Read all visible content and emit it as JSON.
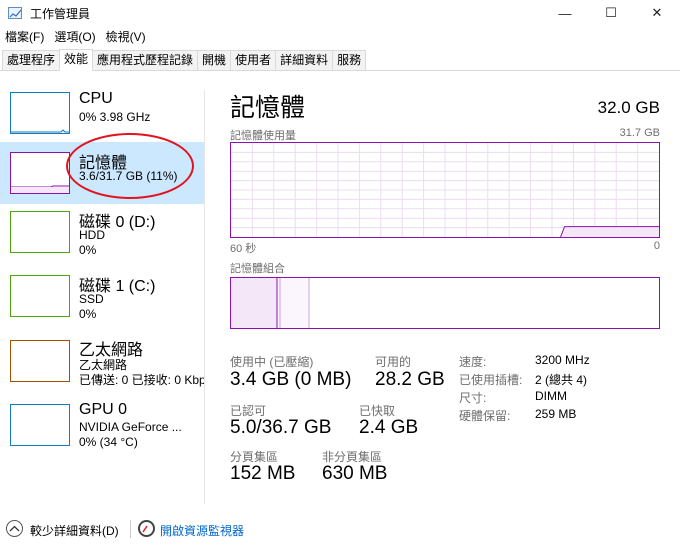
{
  "window": {
    "title": "工作管理員",
    "minimize": "—",
    "maximize": "☐",
    "close": "✕"
  },
  "menu": [
    "檔案(F)",
    "選項(O)",
    "檢視(V)"
  ],
  "tabs": [
    "處理程序",
    "效能",
    "應用程式歷程記錄",
    "開機",
    "使用者",
    "詳細資料",
    "服務"
  ],
  "sidebar": {
    "items": [
      {
        "title": "CPU",
        "sub1": "0% 3.98 GHz",
        "sub2": "",
        "sub3": "",
        "color": "#117dbb"
      },
      {
        "title": "記憶體",
        "sub1": "3.6/31.7 GB (11%)",
        "sub2": "",
        "sub3": "",
        "color": "#8b12ae"
      },
      {
        "title": "磁碟 0 (D:)",
        "sub1": "HDD",
        "sub2": "0%",
        "sub3": "",
        "color": "#4da60c"
      },
      {
        "title": "磁碟 1 (C:)",
        "sub1": "SSD",
        "sub2": "0%",
        "sub3": "",
        "color": "#4da60c"
      },
      {
        "title": "乙太網路",
        "sub1": "乙太網路",
        "sub2": "已傳送: 0 已接收: 0 Kbps",
        "sub3": "",
        "color": "#a74f01"
      },
      {
        "title": "GPU 0",
        "sub1": "NVIDIA GeForce ...",
        "sub2": "0% (34 °C)",
        "sub3": "",
        "color": "#117dbb"
      }
    ]
  },
  "main": {
    "title": "記憶體",
    "total": "32.0 GB",
    "usage_label": "記憶體使用量",
    "usage_max": "31.7 GB",
    "time_left": "60 秒",
    "time_right": "0",
    "composition_label": "記憶體組合",
    "usage_fraction": 0.11,
    "stats": {
      "in_use_label": "使用中 (已壓縮)",
      "in_use_value": "3.4 GB (0 MB)",
      "available_label": "可用的",
      "available_value": "28.2 GB",
      "committed_label": "已認可",
      "committed_value": "5.0/36.7 GB",
      "cached_label": "已快取",
      "cached_value": "2.4 GB",
      "paged_label": "分頁集區",
      "paged_value": "152 MB",
      "nonpaged_label": "非分頁集區",
      "nonpaged_value": "630 MB"
    },
    "specs": [
      {
        "key": "速度:",
        "value": "3200 MHz"
      },
      {
        "key": "已使用插槽:",
        "value": "2 (總共 4)"
      },
      {
        "key": "尺寸:",
        "value": "DIMM"
      },
      {
        "key": "硬體保留:",
        "value": "259 MB"
      }
    ]
  },
  "footer": {
    "fewer_details": "較少詳細資料(D)",
    "open_monitor": "開啟資源監視器"
  },
  "colors": {
    "memory": "#8b12ae",
    "cpu": "#117dbb",
    "disk": "#4da60c",
    "ethernet": "#a74f01",
    "selected": "#cce8ff",
    "annotation": "#e0141e"
  }
}
